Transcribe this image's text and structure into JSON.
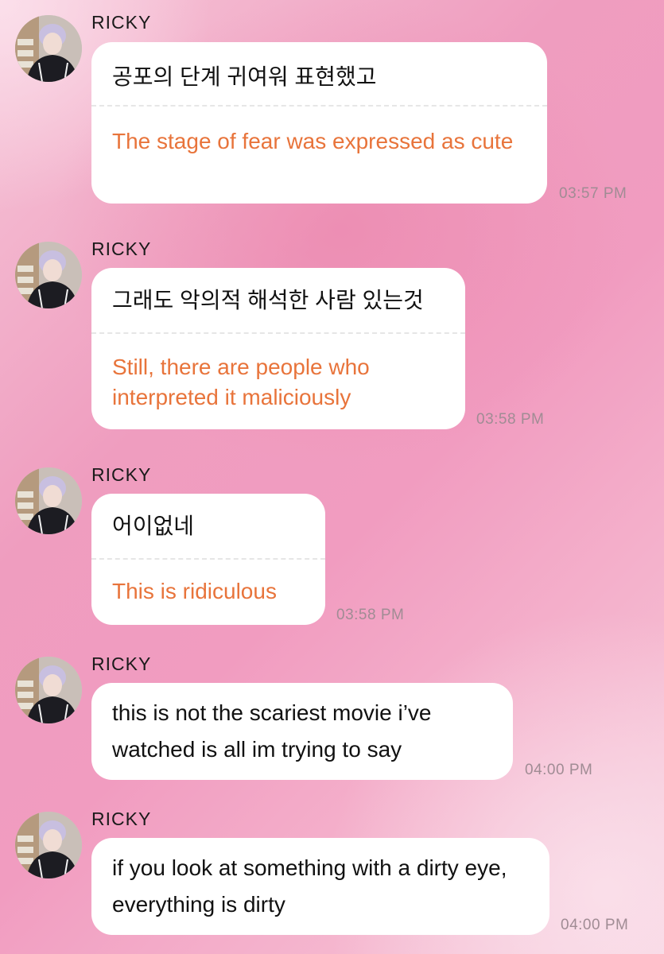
{
  "messages": [
    {
      "sender": "RICKY",
      "original": "공포의 단계 귀여워 표현했고",
      "translation": "The stage of fear was expressed as cute",
      "time": "03:57 PM"
    },
    {
      "sender": "RICKY",
      "original": "그래도 악의적 해석한 사람 있는것",
      "translation": "Still, there are people who interpreted it maliciously",
      "time": "03:58 PM"
    },
    {
      "sender": "RICKY",
      "original": "어이없네",
      "translation": "This is ridiculous",
      "time": "03:58 PM"
    },
    {
      "sender": "RICKY",
      "text": "this is not the scariest movie i’ve watched is all im trying to say",
      "time": "04:00 PM"
    },
    {
      "sender": "RICKY",
      "text": "if you look at something with a dirty eye, everything is dirty",
      "time": "04:00 PM"
    }
  ],
  "colors": {
    "translation": "#e8743b",
    "timestamp": "#a08c94",
    "bubble": "#ffffff"
  },
  "icons": {
    "avatar": "profile-photo-avatar"
  }
}
